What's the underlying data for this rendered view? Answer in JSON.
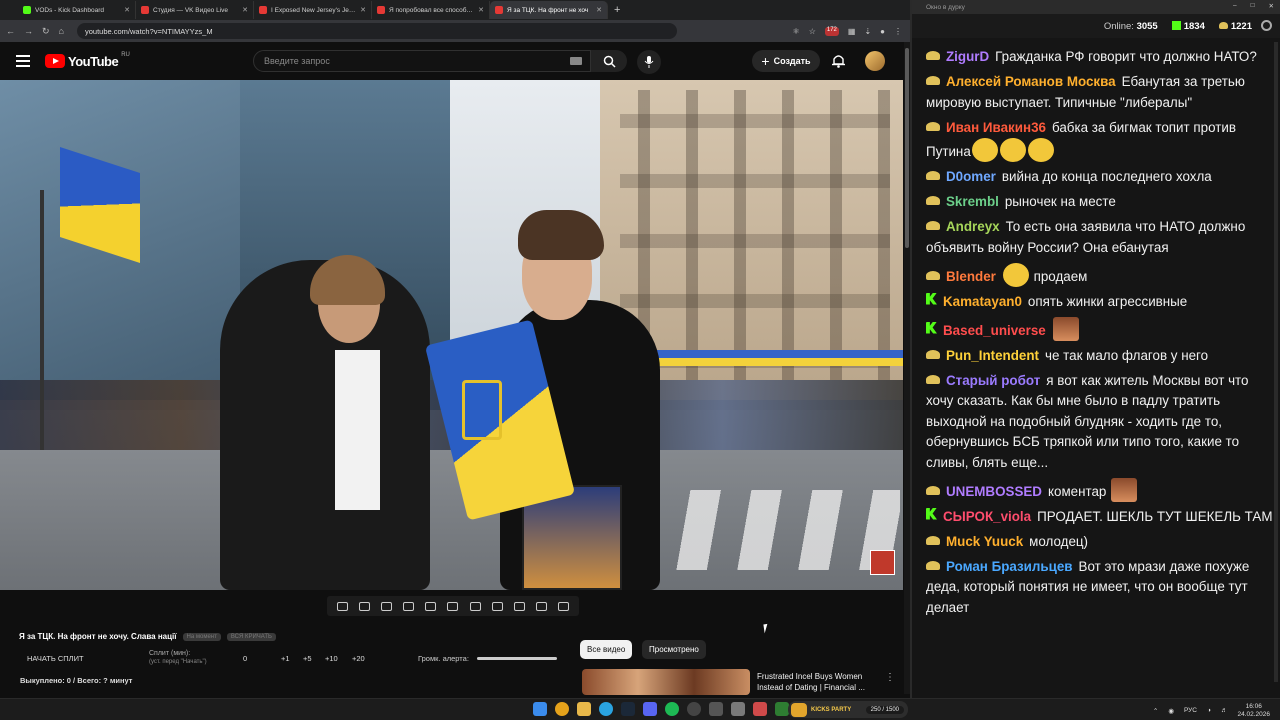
{
  "browser": {
    "tabs": [
      {
        "label": "VODs - Kick Dashboard",
        "color": "#53fc18",
        "active": false
      },
      {
        "label": "Студия — VK Видео Live",
        "color": "#e53935",
        "active": false
      },
      {
        "label": "I Exposed New Jersey's Jewish",
        "color": "#e53935",
        "active": false
      },
      {
        "label": "Я попробовал все способы б",
        "color": "#e53935",
        "active": false
      },
      {
        "label": "Я за ТЦК. На фронт не хоч",
        "color": "#e53935",
        "active": true
      }
    ],
    "url": "youtube.com/watch?v=NTIMAYYzs_M",
    "ext_badges": [
      "172"
    ]
  },
  "youtube": {
    "logo_text": "YouTube",
    "logo_region": "RU",
    "search_placeholder": "Введите запрос",
    "create_label": "Создать"
  },
  "below_video": {
    "title": "Я за ТЦК. На фронт не хочу. Слава нації",
    "pills": [
      "На момент",
      "ВСЯ КРИЧАТЬ"
    ],
    "split_button": "НАЧАТЬ СПЛИТ",
    "split_label": "Сплит (мин):",
    "split_hint": "(уст. перед \"Начать\")",
    "split_values": [
      "0",
      "+1",
      "+5",
      "+10",
      "+20"
    ],
    "alert_label": "Громк. алерта:",
    "bought": "Выкуплено: 0 / Всего: ? минут",
    "chips": [
      "Все видео",
      "Просмотрено"
    ],
    "rec_title": "Frustrated Incel Buys Women Instead of Dating | Financial ..."
  },
  "chat": {
    "window_title": "Окно в дурку",
    "online_label": "Online:",
    "online_value": "3055",
    "kick_count": "1834",
    "coin_count": "1221",
    "messages": [
      {
        "badge": "coin",
        "user": "ZigurD",
        "color": "#b07cff",
        "text": "Гражданка РФ говорит что должно НАТО?"
      },
      {
        "badge": "coin",
        "user": "Алексей Романов Москва",
        "color": "#ffb02e",
        "text": "Ебанутая за третью мировую выступает. Типичные \"либералы\""
      },
      {
        "badge": "coin",
        "user": "Иван Ивакин36",
        "color": "#ff5a3c",
        "text": "бабка за бигмак топит против Путина",
        "emotes": 3
      },
      {
        "badge": "coin",
        "user": "D0omer",
        "color": "#6fa8ff",
        "text": "вийна до конца последнего хохла"
      },
      {
        "badge": "coin",
        "user": "Skrembl",
        "color": "#6ccf8a",
        "text": "рыночек на месте"
      },
      {
        "badge": "coin",
        "user": "Andreyx",
        "color": "#a6d65a",
        "text": "То есть она заявила что НАТО должно объявить войну России? Она ебанутая"
      },
      {
        "badge": "coin",
        "user": "Blender",
        "color": "#ff7a3d",
        "text": "продаем",
        "emote_before": true
      },
      {
        "badge": "kick",
        "user": "Kamatayan0",
        "color": "#ffb02e",
        "text": "опять жинки агрессивные"
      },
      {
        "badge": "kick",
        "user": "Based_universe",
        "color": "#ff4d4d",
        "text": "",
        "face_emote": true
      },
      {
        "badge": "coin",
        "user": "Pun_Intendent",
        "color": "#ffd23a",
        "text": "че так мало флагов у него"
      },
      {
        "badge": "coin",
        "user": "Старый робот",
        "color": "#9b7bff",
        "text": "я вот как житель Москвы вот что хочу сказать. Как бы мне было в падлу тратить выходной на подобный блудняк - ходить где то, обернувшись БСБ тряпкой или типо того, какие то сливы, блять еще..."
      },
      {
        "badge": "coin",
        "user": "UNEMBOSSED",
        "color": "#b07cff",
        "text": "коментар",
        "face_emote": true
      },
      {
        "badge": "kick",
        "user": "СЫРОК_viola",
        "color": "#ff4d6d",
        "text": "ПРОДАЕТ. ШЕКЛЬ ТУТ ШЕКЕЛЬ ТАМ"
      },
      {
        "badge": "coin",
        "user": "Muck Yuuck",
        "color": "#ffb02e",
        "text": "молодец)"
      },
      {
        "badge": "coin",
        "user": "Роман Бразильцев",
        "color": "#4aa8ff",
        "text": "Вот это мрази даже похуже деда, который понятия не имеет, что он вообще тут делает"
      }
    ]
  },
  "taskbar": {
    "kick_label": "KICKS PARTY",
    "kick_counter": "250 / 1500",
    "lang": "РУС",
    "time": "16:06",
    "date": "24.02.2026"
  }
}
